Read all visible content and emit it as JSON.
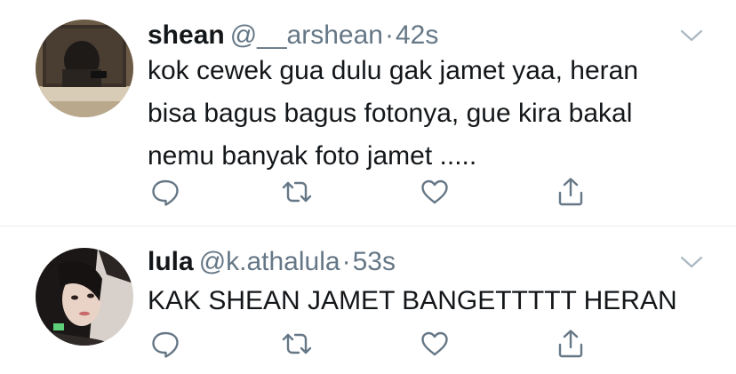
{
  "colors": {
    "background": "#ffffff",
    "text_primary": "#14171a",
    "text_secondary": "#657786",
    "divider": "#e6ecf0",
    "icon": "#657786"
  },
  "tweets": [
    {
      "display_name": "shean",
      "handle": "@__arshean",
      "separator": "·",
      "time": "42s",
      "text": "kok cewek gua dulu gak jamet yaa, heran bisa bagus bagus fotonya, gue kira bakal nemu banyak foto jamet .....",
      "avatar_icon": "profile-photo",
      "actions": [
        "reply-icon",
        "retweet-icon",
        "like-icon",
        "share-icon"
      ]
    },
    {
      "display_name": "lula",
      "handle": "@k.athalula",
      "separator": "·",
      "time": "53s",
      "text": "KAK SHEAN JAMET BANGETTTTT HERAN",
      "avatar_icon": "profile-photo",
      "actions": [
        "reply-icon",
        "retweet-icon",
        "like-icon",
        "share-icon"
      ]
    }
  ]
}
